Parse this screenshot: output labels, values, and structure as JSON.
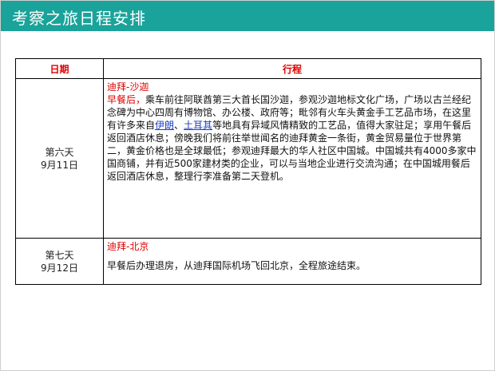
{
  "header": {
    "title": "考察之旅日程安排"
  },
  "table": {
    "col_date": "日期",
    "col_plan": "行程",
    "rows": [
      {
        "day": "第六天",
        "date": "9月11日",
        "route": "迪拜-沙迦",
        "lead": "早餐后，",
        "p1": "乘车前往阿联酋第三大首长国沙迦，参观沙迦地标文化广场，广场以古兰经纪念碑为中心四周有博物馆、办公楼、政府等；毗邻有火车头黄金手工艺品市场，在这里有许多来自",
        "link1": "伊朗",
        "sep": "、",
        "link2": "土耳其",
        "p2": "等地具有异域风情精致的工艺品，值得大家驻足；享用午餐后返回酒店休息；傍晚我们将前往举世闻名的迪拜黄金一条街，黄金贸易量位于世界第二，黄金价格也是全球最低；参观迪拜最大的华人社区中国城。中国城共有4000多家中国商铺，并有近500家建材类的企业，可以与当地企业进行交流沟通；在中国城用餐后返回酒店休息，整理行李准备第二天登机。"
      },
      {
        "day": "第七天",
        "date": "9月12日",
        "route": "迪拜-北京",
        "p1": "早餐后办理退房，从迪拜国际机场飞回北京，全程旅途结束。"
      }
    ]
  }
}
